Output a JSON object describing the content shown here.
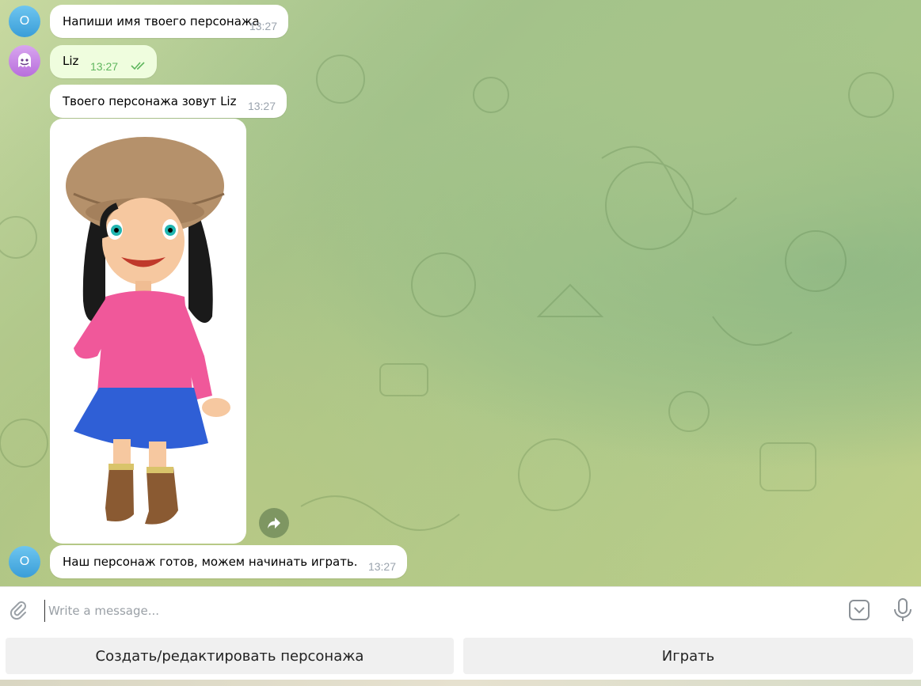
{
  "messages": [
    {
      "avatar": "O",
      "text": "Напиши имя твоего персонажа",
      "time": "13:27"
    },
    {
      "avatar": "user-avatar",
      "text": "Liz",
      "time": "13:27",
      "status": "read-double-check"
    },
    {
      "avatar": "",
      "text": "Твоего персонажа зовут Liz",
      "time": "13:27"
    },
    {
      "avatar": "",
      "image": "girl-character-illustration"
    },
    {
      "avatar": "O",
      "text": "Наш персонаж готов, можем начинать играть.",
      "time": "13:27"
    }
  ],
  "composer": {
    "placeholder": "Write a message..."
  },
  "keyboard": {
    "buttons": [
      "Создать/редактировать персонажа",
      "Играть"
    ]
  },
  "colors": {
    "incoming_bubble": "#ffffff",
    "outgoing_bubble": "#effdde",
    "outgoing_time": "#5fb65e",
    "avatar_bot": "#3a9ed8",
    "avatar_user": "#b86edc"
  },
  "icons": [
    "paperclip-icon",
    "bot-command-icon",
    "microphone-icon",
    "forward-icon",
    "double-check-icon"
  ]
}
